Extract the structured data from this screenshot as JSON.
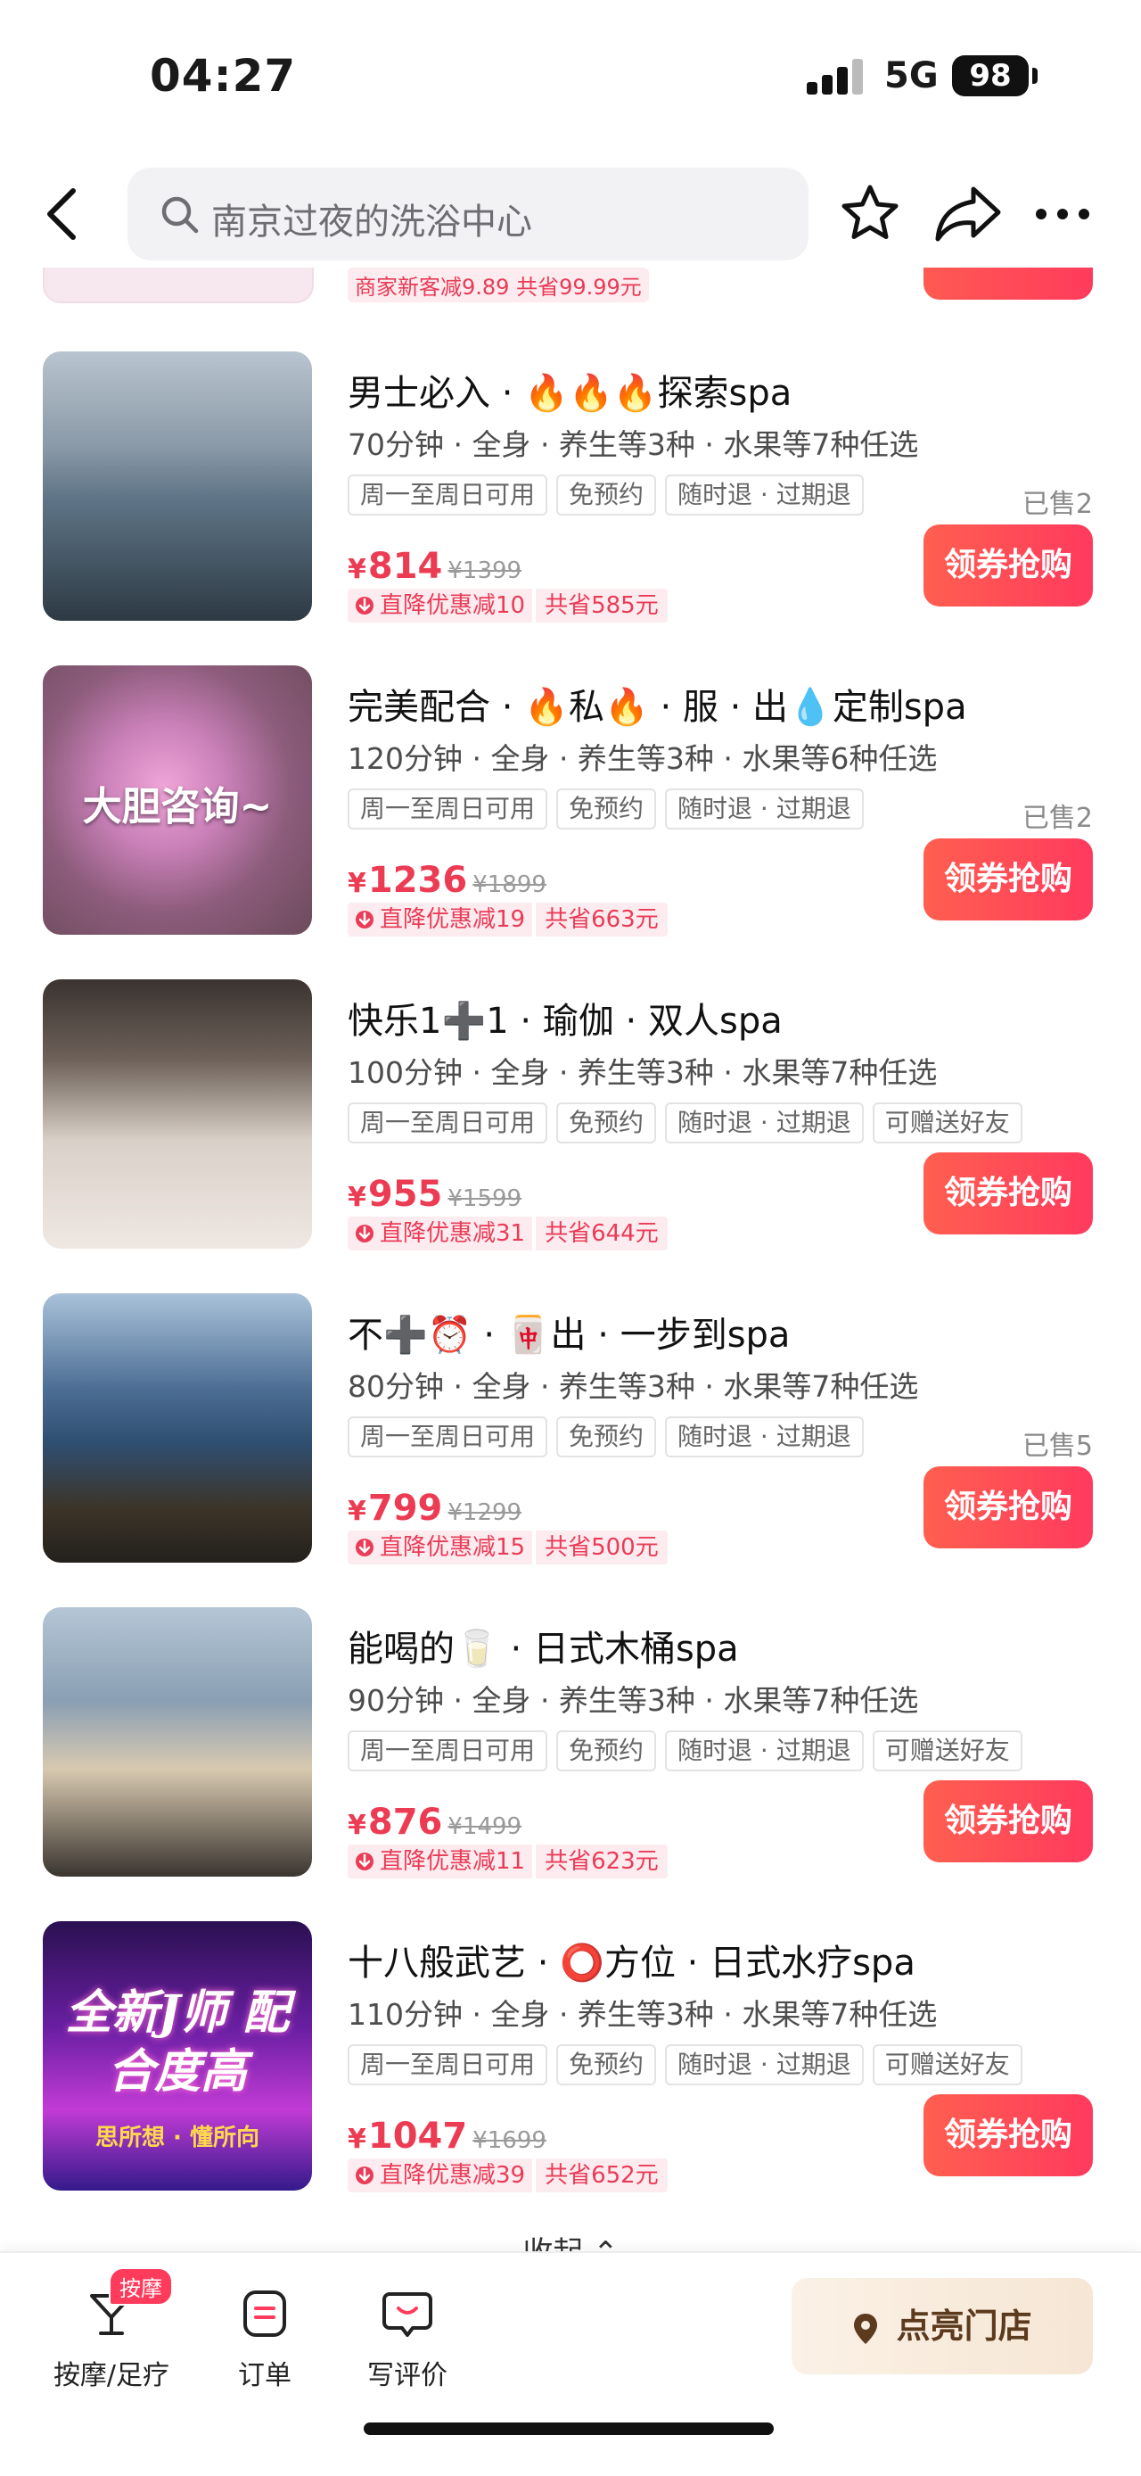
{
  "status_bar": {
    "time": "04:27",
    "network": "5G",
    "battery": "98"
  },
  "nav": {
    "search_placeholder": "南京过夜的洗浴中心"
  },
  "partial_card": {
    "promo": "商家新客减9.89 共省99.99元"
  },
  "products": [
    {
      "title": "男士必入 · 🔥🔥🔥探索spa",
      "specs": "70分钟 · 全身 · 养生等3种 · 水果等7种任选",
      "tags": [
        "周一至周日可用",
        "免预约",
        "随时退 · 过期退"
      ],
      "sold": "已售2",
      "currency": "¥",
      "price": "814",
      "original_price": "¥1399",
      "promo": "直降优惠减10",
      "save": "共省585元",
      "button": "领券抢购",
      "thumb_text": ""
    },
    {
      "title": "完美配合 · 🔥私🔥 · 服 · 出💧定制spa",
      "specs": "120分钟 · 全身 · 养生等3种 · 水果等6种任选",
      "tags": [
        "周一至周日可用",
        "免预约",
        "随时退 · 过期退"
      ],
      "sold": "已售2",
      "currency": "¥",
      "price": "1236",
      "original_price": "¥1899",
      "promo": "直降优惠减19",
      "save": "共省663元",
      "button": "领券抢购",
      "thumb_text": "大胆咨询~"
    },
    {
      "title": "快乐1➕1 · 瑜伽 · 双人spa",
      "specs": "100分钟 · 全身 · 养生等3种 · 水果等7种任选",
      "tags": [
        "周一至周日可用",
        "免预约",
        "随时退 · 过期退",
        "可赠送好友"
      ],
      "sold": "",
      "currency": "¥",
      "price": "955",
      "original_price": "¥1599",
      "promo": "直降优惠减31",
      "save": "共省644元",
      "button": "领券抢购",
      "thumb_text": ""
    },
    {
      "title": "不➕⏰ · 🀄出 · 一步到spa",
      "specs": "80分钟 · 全身 · 养生等3种 · 水果等7种任选",
      "tags": [
        "周一至周日可用",
        "免预约",
        "随时退 · 过期退"
      ],
      "sold": "已售5",
      "currency": "¥",
      "price": "799",
      "original_price": "¥1299",
      "promo": "直降优惠减15",
      "save": "共省500元",
      "button": "领券抢购",
      "thumb_text": ""
    },
    {
      "title": "能喝的🥛 · 日式木桶spa",
      "specs": "90分钟 · 全身 · 养生等3种 · 水果等7种任选",
      "tags": [
        "周一至周日可用",
        "免预约",
        "随时退 · 过期退",
        "可赠送好友"
      ],
      "sold": "",
      "currency": "¥",
      "price": "876",
      "original_price": "¥1499",
      "promo": "直降优惠减11",
      "save": "共省623元",
      "button": "领券抢购",
      "thumb_text": ""
    },
    {
      "title": "十八般武艺 · ⭕方位 · 日式水疗spa",
      "specs": "110分钟 · 全身 · 养生等3种 · 水果等7种任选",
      "tags": [
        "周一至周日可用",
        "免预约",
        "随时退 · 过期退",
        "可赠送好友"
      ],
      "sold": "",
      "currency": "¥",
      "price": "1047",
      "original_price": "¥1699",
      "promo": "直降优惠减39",
      "save": "共省652元",
      "button": "领券抢购",
      "thumb_text": "全新J师 配合度高",
      "thumb_subtext": "思所想 · 懂所向"
    }
  ],
  "collapse_label": "收起 ⌃",
  "bottom_bar": {
    "tabs": [
      {
        "label": "按摩/足疗",
        "badge": "按摩",
        "icon": "cocktail-icon"
      },
      {
        "label": "订单",
        "icon": "order-icon"
      },
      {
        "label": "写评价",
        "icon": "review-icon"
      }
    ],
    "store_button": "点亮门店"
  },
  "colors": {
    "accent": "#ff3b5c",
    "price": "#ec3c54",
    "promo_bg": "#fdecef"
  }
}
